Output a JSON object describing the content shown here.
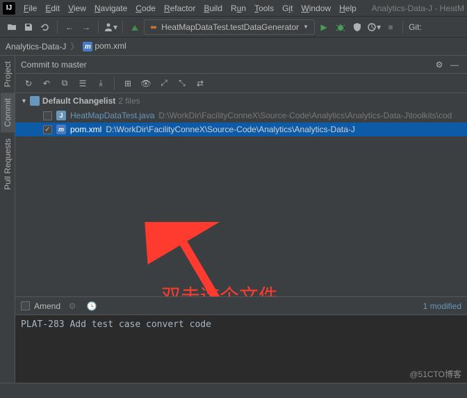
{
  "title_right": "Analytics-Data-J - HeatM",
  "menu": {
    "file": "File",
    "edit": "Edit",
    "view": "View",
    "navigate": "Navigate",
    "code": "Code",
    "refactor": "Refactor",
    "build": "Build",
    "run": "Run",
    "tools": "Tools",
    "git": "Git",
    "window": "Window",
    "help": "Help"
  },
  "run_config": {
    "label": "HeatMapDataTest.testDataGenerator"
  },
  "git_label": "Git:",
  "breadcrumb": {
    "project": "Analytics-Data-J",
    "file": "pom.xml"
  },
  "side_tabs": {
    "project": "Project",
    "commit": "Commit",
    "pull": "Pull Requests"
  },
  "panel_title": "Commit to master",
  "changelist": {
    "name": "Default Changelist",
    "count": "2 files",
    "files": [
      {
        "checked": false,
        "name": "HeatMapDataTest.java",
        "path": "D:\\WorkDir\\FacilityConneX\\Source-Code\\Analytics\\Analytics-Data-J\\toolkits\\cod",
        "type": "java",
        "sel": false
      },
      {
        "checked": true,
        "name": "pom.xml",
        "path": "D:\\WorkDir\\FacilityConneX\\Source-Code\\Analytics\\Analytics-Data-J",
        "type": "xml",
        "sel": true
      }
    ]
  },
  "amend": {
    "label": "Amend",
    "status": "1 modified"
  },
  "commit_msg": "PLAT-283 Add test case convert code",
  "annotation": "双击这个文件",
  "watermark": "@51CTO博客"
}
